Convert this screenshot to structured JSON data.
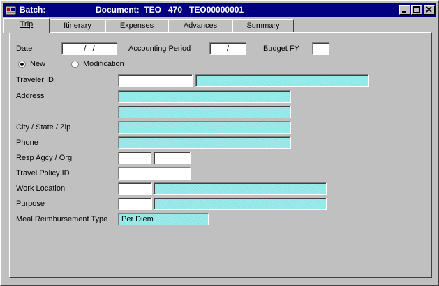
{
  "titlebar": {
    "batch_label": "Batch:",
    "document_label": "Document:  TEO   470   TEO00000001"
  },
  "tabs": [
    {
      "label": "Trip"
    },
    {
      "label": "Itinerary"
    },
    {
      "label": "Expenses"
    },
    {
      "label": "Advances"
    },
    {
      "label": "Summary"
    }
  ],
  "form": {
    "date_label": "Date",
    "date_value": "/   /",
    "accounting_period_label": "Accounting Period",
    "accounting_period_value": "/",
    "budget_fy_label": "Budget FY",
    "budget_fy_value": "",
    "radio_new_label": "New",
    "radio_modification_label": "Modification",
    "traveler_id_label": "Traveler ID",
    "address_label": "Address",
    "city_state_zip_label": "City / State / Zip",
    "phone_label": "Phone",
    "resp_agcy_org_label": "Resp Agcy / Org",
    "travel_policy_id_label": "Travel Policy ID",
    "work_location_label": "Work Location",
    "purpose_label": "Purpose",
    "meal_reimbursement_type_label": "Meal Reimbursement Type",
    "meal_reimbursement_type_value": "Per Diem"
  },
  "colors": {
    "title_bar": "#000080",
    "readonly_field": "#8ee6e6",
    "window_bg": "#c0c0c0"
  },
  "icons": {
    "app": "app-icon",
    "minimize": "minimize-icon",
    "maximize": "maximize-icon",
    "close": "close-icon"
  }
}
